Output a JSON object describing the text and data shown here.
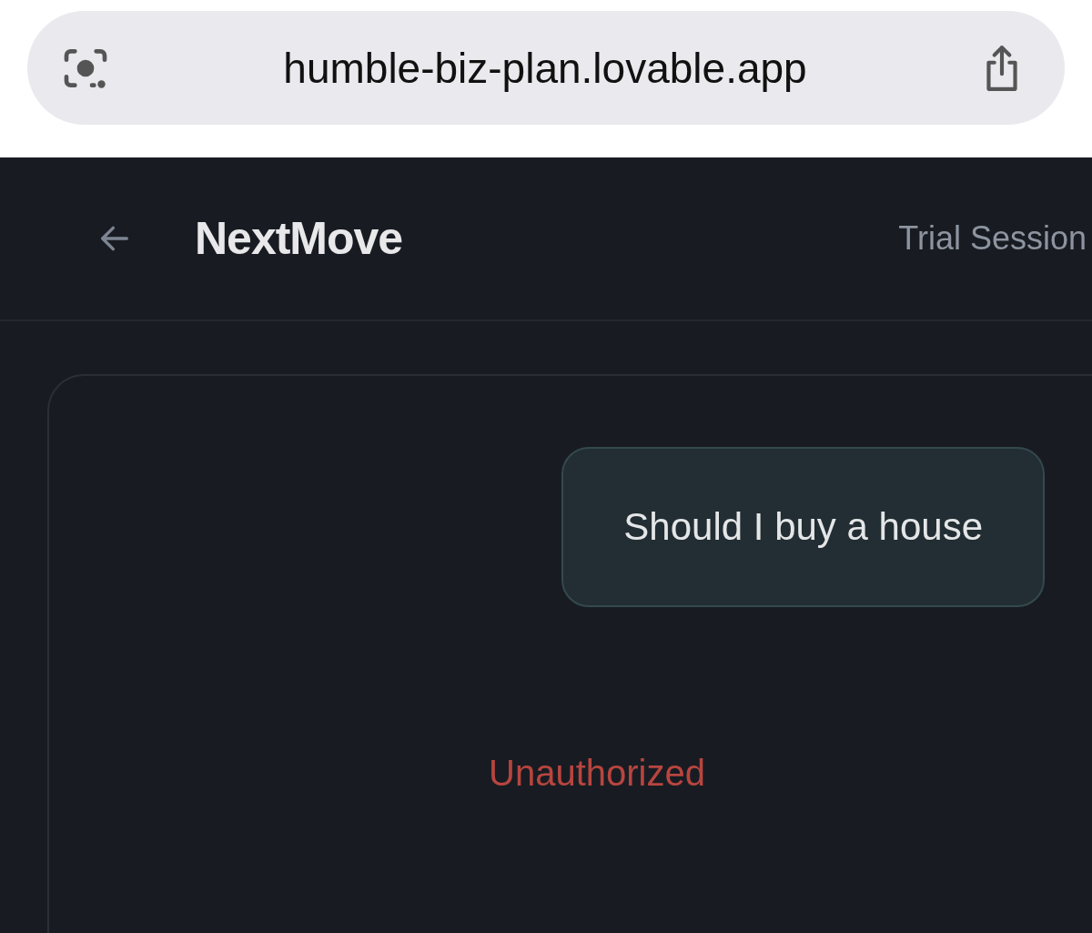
{
  "browser_bar": {
    "url": "humble-biz-plan.lovable.app"
  },
  "header": {
    "title": "NextMove",
    "session_label": "Trial Session"
  },
  "chat": {
    "messages": [
      {
        "kind": "user",
        "text": "Should I buy a house"
      },
      {
        "kind": "error",
        "text": "Unauthorized"
      }
    ]
  }
}
